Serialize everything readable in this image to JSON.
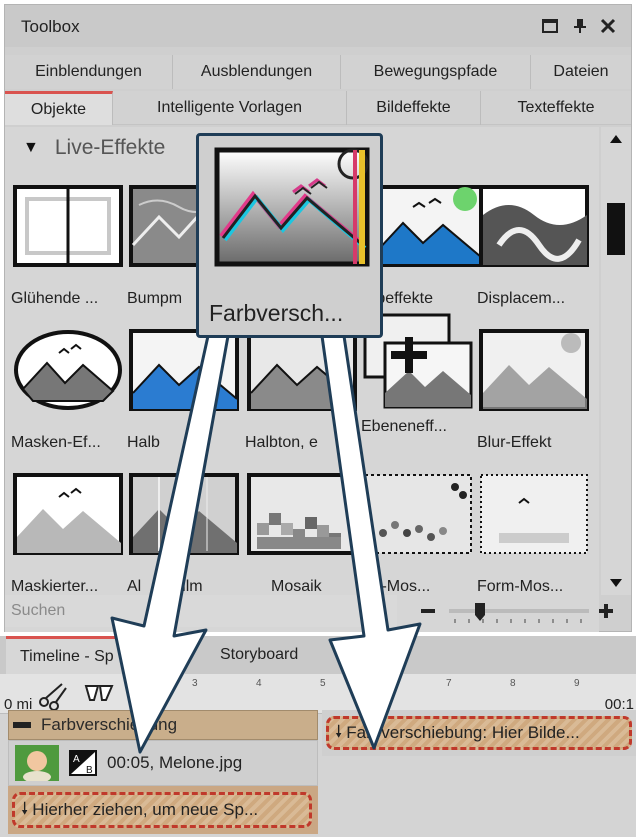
{
  "toolbox": {
    "title": "Toolbox",
    "tabs_row1": [
      "Einblendungen",
      "Ausblendungen",
      "Bewegungspfade",
      "Dateien"
    ],
    "tabs_row2": [
      "Objekte",
      "Intelligente Vorlagen",
      "Bildeffekte",
      "Texteffekte"
    ],
    "active_tab": "Objekte",
    "section_title": "Live-Effekte",
    "effects": [
      {
        "label": "Glühende ...",
        "icon": "glow-frame-icon"
      },
      {
        "label": "Bumpm",
        "icon": "bumpmap-icon"
      },
      {
        "label": "Farbversch...",
        "icon": "color-shift-icon"
      },
      {
        "label": "rbeffekte",
        "icon": "color-effects-icon"
      },
      {
        "label": "Displacem...",
        "icon": "displacement-icon"
      },
      {
        "label": "Masken-Ef...",
        "icon": "mask-ellipse-icon"
      },
      {
        "label": "Halb",
        "icon": "halftone-blue-icon"
      },
      {
        "label": "Halbton, e",
        "icon": "halftone-gray-icon"
      },
      {
        "label": "Ebeneneff...",
        "icon": "layer-effect-icon"
      },
      {
        "label": "Blur-Effekt",
        "icon": "blur-icon"
      },
      {
        "label": "Maskierter...",
        "icon": "masked-icon"
      },
      {
        "label": "Al",
        "icon": "old-film-icon"
      },
      {
        "label": "Film",
        "icon": "old-film-icon"
      },
      {
        "label": "Mosaik",
        "icon": "mosaic-icon"
      },
      {
        "label": "eis-Mos...",
        "icon": "circle-mosaic-icon"
      },
      {
        "label": "Form-Mos...",
        "icon": "shape-mosaic-icon"
      }
    ],
    "search_placeholder": "Suchen"
  },
  "popup": {
    "label": "Farbversch..."
  },
  "timeline": {
    "tabs": [
      "Timeline - Sp",
      "nt",
      "Storyboard"
    ],
    "ruler_ticks": [
      "3",
      "4",
      "5",
      "7",
      "8",
      "9"
    ],
    "time_left": "0 mi",
    "time_right": "00:1",
    "track_header": "Farbverschiebung",
    "media_duration": "00:05, Melone.jpg",
    "drop_left": "Hierher ziehen, um neue Sp...",
    "drop_right": "Farbverschiebung: Hier Bilde..."
  },
  "colors": {
    "accent_red": "#d9534f",
    "dashed_red": "#c0392b",
    "popup_border": "#1f3d57",
    "arrow_border": "#1f3d57"
  }
}
